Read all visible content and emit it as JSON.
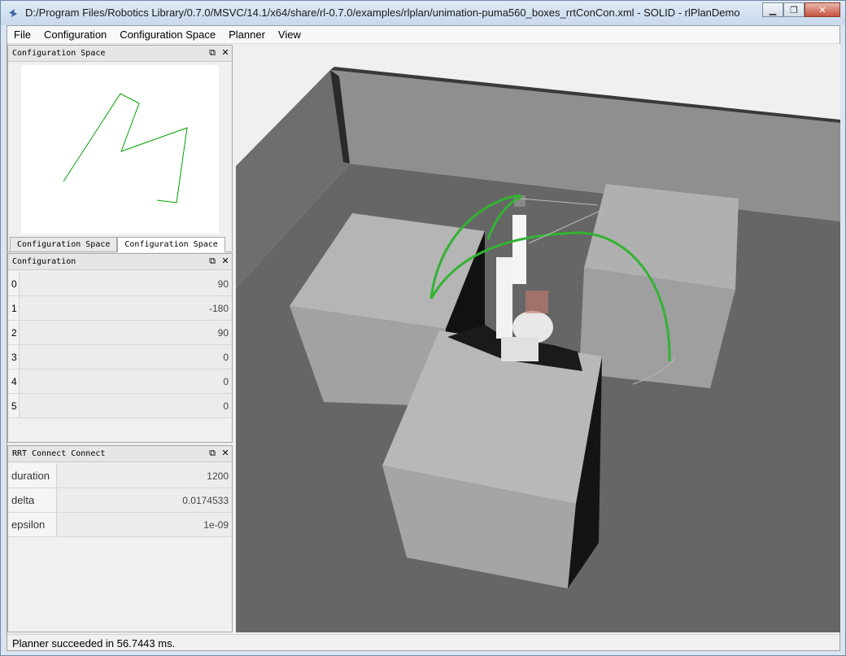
{
  "window": {
    "title": "D:/Program Files/Robotics Library/0.7.0/MSVC/14.1/x64/share/rl-0.7.0/examples/rlplan/unimation-puma560_boxes_rrtConCon.xml - SOLID - rlPlanDemo"
  },
  "menu": {
    "items": [
      "File",
      "Configuration",
      "Configuration Space",
      "Planner",
      "View"
    ]
  },
  "cspace_dock": {
    "title": "Configuration Space",
    "tabs": [
      "Configuration Space",
      "Configuration Space"
    ]
  },
  "config_dock": {
    "title": "Configuration",
    "rows": [
      {
        "index": "0",
        "value": "90"
      },
      {
        "index": "1",
        "value": "-180"
      },
      {
        "index": "2",
        "value": "90"
      },
      {
        "index": "3",
        "value": "0"
      },
      {
        "index": "4",
        "value": "0"
      },
      {
        "index": "5",
        "value": "0"
      }
    ]
  },
  "planner_dock": {
    "title": "RRT Connect Connect",
    "rows": [
      {
        "label": "duration",
        "value": "1200"
      },
      {
        "label": "delta",
        "value": "0.0174533"
      },
      {
        "label": "epsilon",
        "value": "1e-09"
      }
    ]
  },
  "status": {
    "text": "Planner succeeded in 56.7443 ms."
  },
  "colors": {
    "path": "#00a000",
    "path3d": "#33b333"
  }
}
